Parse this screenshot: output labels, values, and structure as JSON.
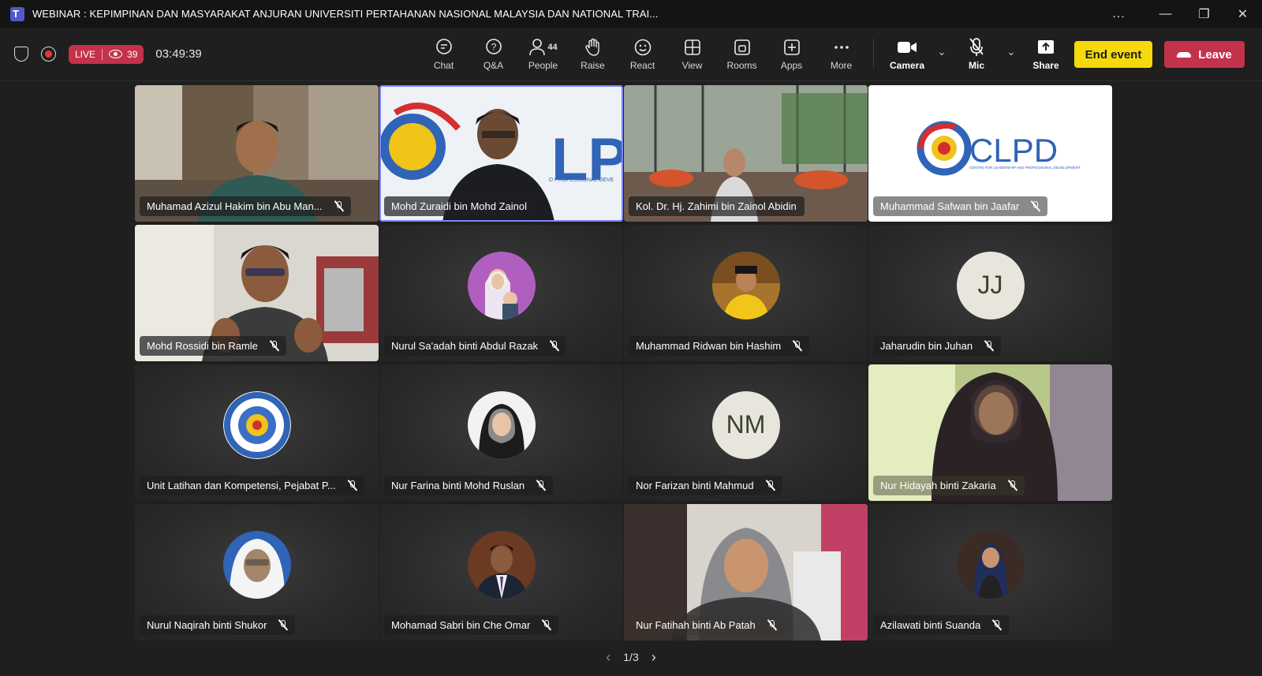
{
  "window": {
    "title": "WEBINAR : KEPIMPINAN DAN MASYARAKAT ANJURAN UNIVERSITI PERTAHANAN NASIONAL MALAYSIA DAN NATIONAL TRAI...",
    "controls": [
      "...",
      "—",
      "❐",
      "✕"
    ]
  },
  "meeting": {
    "live_label": "LIVE",
    "viewers": "39",
    "elapsed": "03:49:39"
  },
  "toolbar": {
    "items": [
      {
        "label": "Chat",
        "icon": "chat-icon"
      },
      {
        "label": "Q&A",
        "icon": "qa-icon"
      },
      {
        "label": "People",
        "icon": "people-icon",
        "count": "44"
      },
      {
        "label": "Raise",
        "icon": "raise-hand-icon"
      },
      {
        "label": "React",
        "icon": "react-icon"
      },
      {
        "label": "View",
        "icon": "view-icon"
      },
      {
        "label": "Rooms",
        "icon": "rooms-icon"
      },
      {
        "label": "Apps",
        "icon": "apps-icon"
      },
      {
        "label": "More",
        "icon": "more-icon"
      }
    ],
    "camera_label": "Camera",
    "mic_label": "Mic",
    "share_label": "Share",
    "end_event_label": "End event",
    "leave_label": "Leave",
    "end_color": "#f5d90a",
    "leave_color": "#c4314b"
  },
  "participants": [
    {
      "name": "Muhamad Azizul Hakim bin Abu Man...",
      "muted": true,
      "type": "video"
    },
    {
      "name": "Mohd Zuraidi bin Mohd Zainol",
      "muted": false,
      "type": "video",
      "active": true
    },
    {
      "name": "Kol. Dr. Hj. Zahimi bin Zainol Abidin",
      "muted": false,
      "type": "video"
    },
    {
      "name": "Muhammad Safwan bin Jaafar",
      "muted": true,
      "type": "logo",
      "logo_text": "CLPD",
      "logo_sub": "CENTRE FOR LEADERSHIP AND PROFESSIONAL DEVELOPMENT"
    },
    {
      "name": "Mohd Rossidi bin Ramle",
      "muted": true,
      "type": "video"
    },
    {
      "name": "Nurul Sa'adah binti Abdul Razak",
      "muted": true,
      "type": "avatar"
    },
    {
      "name": "Muhammad Ridwan bin Hashim",
      "muted": true,
      "type": "avatar"
    },
    {
      "name": "Jaharudin bin Juhan",
      "muted": true,
      "type": "initials",
      "initials": "JJ"
    },
    {
      "name": "Unit Latihan dan Kompetensi, Pejabat P...",
      "muted": true,
      "type": "avatar"
    },
    {
      "name": "Nur Farina binti Mohd Ruslan",
      "muted": true,
      "type": "avatar"
    },
    {
      "name": "Nor Farizan binti Mahmud",
      "muted": true,
      "type": "initials",
      "initials": "NM"
    },
    {
      "name": "Nur Hidayah binti Zakaria",
      "muted": true,
      "type": "video"
    },
    {
      "name": "Nurul Naqirah binti Shukor",
      "muted": true,
      "type": "avatar"
    },
    {
      "name": "Mohamad Sabri bin Che Omar",
      "muted": true,
      "type": "avatar"
    },
    {
      "name": "Nur Fatihah binti Ab Patah",
      "muted": true,
      "type": "video"
    },
    {
      "name": "Azilawati binti Suanda",
      "muted": true,
      "type": "avatar"
    }
  ],
  "pager": {
    "text": "1/3"
  }
}
